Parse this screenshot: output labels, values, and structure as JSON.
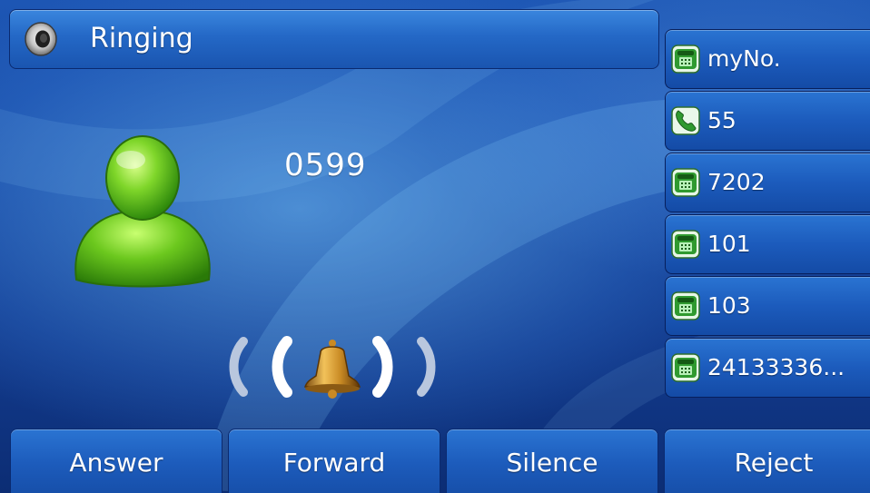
{
  "header": {
    "status": "Ringing",
    "icon": "speaker-icon"
  },
  "call": {
    "caller_number": "0599",
    "avatar_icon": "contact-avatar-icon",
    "ring_icon": "bell-icon"
  },
  "line_keys": [
    {
      "label": "myNo.",
      "icon": "desk-phone-icon"
    },
    {
      "label": "55",
      "icon": "handset-icon"
    },
    {
      "label": "7202",
      "icon": "desk-phone-icon"
    },
    {
      "label": "101",
      "icon": "desk-phone-icon"
    },
    {
      "label": "103",
      "icon": "desk-phone-icon"
    },
    {
      "label": "24133336...",
      "icon": "desk-phone-icon"
    }
  ],
  "softkeys": {
    "answer": "Answer",
    "forward": "Forward",
    "silence": "Silence",
    "reject": "Reject"
  },
  "colors": {
    "key_blue": "#1c5bbc",
    "background": "#184aa4",
    "icon_green": "#3fbf3f"
  }
}
